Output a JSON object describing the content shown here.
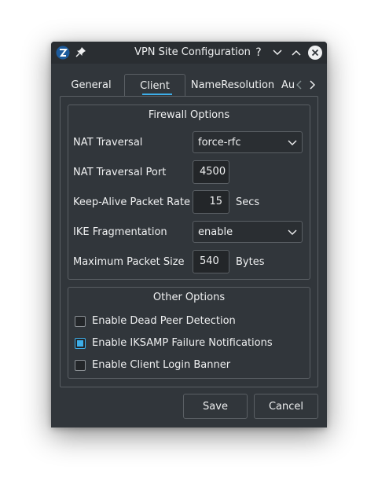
{
  "window": {
    "title": "VPN Site Configuration",
    "help_glyph": "?",
    "minimize_glyph": "⌄",
    "maximize_glyph": "⌃"
  },
  "tabs": [
    {
      "label": "General",
      "active": false
    },
    {
      "label": "Client",
      "active": true
    },
    {
      "label": "NameResolution",
      "active": false
    },
    {
      "label": "Au",
      "active": false
    }
  ],
  "firewall": {
    "title": "Firewall Options",
    "nat_traversal": {
      "label": "NAT Traversal",
      "value": "force-rfc"
    },
    "nat_traversal_port": {
      "label": "NAT Traversal Port",
      "value": "4500"
    },
    "keep_alive": {
      "label": "Keep-Alive Packet Rate",
      "value": "15",
      "unit": "Secs"
    },
    "ike_fragmentation": {
      "label": "IKE Fragmentation",
      "value": "enable"
    },
    "max_packet_size": {
      "label": "Maximum Packet Size",
      "value": "540",
      "unit": "Bytes"
    }
  },
  "other": {
    "title": "Other Options",
    "options": [
      {
        "label": "Enable Dead Peer Detection",
        "checked": false
      },
      {
        "label": "Enable IKSAMP Failure Notifications",
        "checked": true
      },
      {
        "label": "Enable Client Login Banner",
        "checked": false
      }
    ]
  },
  "buttons": {
    "save": "Save",
    "cancel": "Cancel"
  },
  "colors": {
    "window_bg": "#31363b",
    "accent": "#3daee9",
    "text": "#eff0f1",
    "border": "#5a5f64"
  }
}
